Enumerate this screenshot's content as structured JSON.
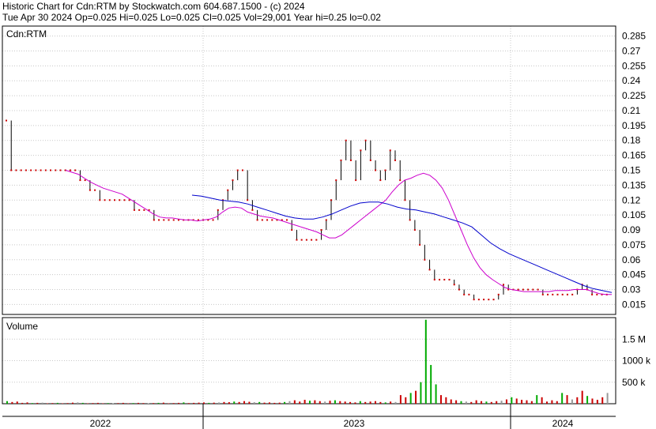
{
  "header": {
    "title": "Historic Chart for Cdn:RTM by Stockwatch.com 604.687.1500 - (c) 2024",
    "stats": "Tue Apr 30 2024  Op=0.025  Hi=0.025  Lo=0.025  Cl=0.025  Vol=29,001  Year hi=0.25  lo=0.02"
  },
  "price_panel": {
    "label": "Cdn:RTM"
  },
  "volume_panel": {
    "label": "Volume"
  },
  "colors": {
    "grid": "#c8c8c8",
    "bar": "#000000",
    "dot": "#cc0000",
    "ma_short": "#cc00cc",
    "ma_long": "#0000cc",
    "vol_up": "#00aa00",
    "vol_down": "#cc0000",
    "vol_flat": "#999999"
  },
  "chart_data": [
    {
      "type": "line",
      "title": "Cdn:RTM",
      "x_labels": [
        "2022",
        "2023",
        "2024"
      ],
      "y_ticks": [
        0.015,
        0.03,
        0.045,
        0.06,
        0.075,
        0.09,
        0.105,
        0.12,
        0.135,
        0.15,
        0.165,
        0.18,
        0.195,
        0.21,
        0.225,
        0.24,
        0.255,
        0.27,
        0.285
      ],
      "ylim": [
        0.005,
        0.295
      ],
      "grid": true,
      "series": [
        {
          "style": "price",
          "values": [
            0.2,
            0.15,
            0.15,
            0.15,
            0.15,
            0.15,
            0.15,
            0.15,
            0.15,
            0.15,
            0.15,
            0.15,
            0.15,
            0.15,
            0.15,
            0.14,
            0.14,
            0.13,
            0.13,
            0.12,
            0.12,
            0.12,
            0.12,
            0.12,
            0.12,
            0.12,
            0.11,
            0.11,
            0.11,
            0.11,
            0.1,
            0.1,
            0.1,
            0.1,
            0.1,
            0.1,
            0.1,
            0.1,
            0.1,
            0.1,
            0.1,
            0.1,
            0.1,
            0.11,
            0.12,
            0.13,
            0.14,
            0.15,
            0.15,
            0.12,
            0.11,
            0.1,
            0.1,
            0.1,
            0.1,
            0.1,
            0.1,
            0.1,
            0.09,
            0.08,
            0.08,
            0.08,
            0.08,
            0.08,
            0.09,
            0.1,
            0.12,
            0.14,
            0.16,
            0.18,
            0.16,
            0.14,
            0.17,
            0.18,
            0.16,
            0.15,
            0.14,
            0.15,
            0.17,
            0.16,
            0.14,
            0.12,
            0.1,
            0.09,
            0.075,
            0.06,
            0.05,
            0.04,
            0.04,
            0.04,
            0.04,
            0.035,
            0.03,
            0.025,
            0.025,
            0.02,
            0.02,
            0.02,
            0.02,
            0.02,
            0.025,
            0.035,
            0.03,
            0.03,
            0.03,
            0.03,
            0.03,
            0.03,
            0.03,
            0.025,
            0.025,
            0.025,
            0.025,
            0.025,
            0.025,
            0.025,
            0.03,
            0.035,
            0.03,
            0.025,
            0.025,
            0.025,
            0.025
          ]
        },
        {
          "name": "",
          "style": "ma_short",
          "values": [
            0.15,
            0.148,
            0.146,
            0.142,
            0.138,
            0.135,
            0.132,
            0.13,
            0.128,
            0.126,
            0.122,
            0.118,
            0.114,
            0.11,
            0.106,
            0.103,
            0.102,
            0.102,
            0.101,
            0.1,
            0.1,
            0.099,
            0.1,
            0.101,
            0.103,
            0.108,
            0.112,
            0.113,
            0.112,
            0.108,
            0.106,
            0.104,
            0.103,
            0.102,
            0.1,
            0.098,
            0.096,
            0.094,
            0.092,
            0.09,
            0.088,
            0.085,
            0.082,
            0.082,
            0.085,
            0.09,
            0.095,
            0.1,
            0.105,
            0.11,
            0.115,
            0.12,
            0.128,
            0.135,
            0.14,
            0.142,
            0.145,
            0.147,
            0.145,
            0.14,
            0.132,
            0.12,
            0.105,
            0.09,
            0.075,
            0.062,
            0.052,
            0.045,
            0.04,
            0.036,
            0.032,
            0.03,
            0.029,
            0.028,
            0.028,
            0.028,
            0.028,
            0.028,
            0.029,
            0.029,
            0.029,
            0.03,
            0.03,
            0.03,
            0.028,
            0.026,
            0.025,
            0.025
          ]
        },
        {
          "name": "",
          "style": "ma_long",
          "values": [
            0.125,
            0.124,
            0.122,
            0.12,
            0.119,
            0.118,
            0.116,
            0.113,
            0.11,
            0.107,
            0.104,
            0.102,
            0.101,
            0.101,
            0.103,
            0.106,
            0.11,
            0.114,
            0.117,
            0.118,
            0.118,
            0.116,
            0.113,
            0.111,
            0.11,
            0.108,
            0.106,
            0.103,
            0.1,
            0.097,
            0.093,
            0.085,
            0.077,
            0.071,
            0.066,
            0.062,
            0.058,
            0.054,
            0.05,
            0.046,
            0.042,
            0.038,
            0.034,
            0.031,
            0.029,
            0.027
          ]
        }
      ]
    },
    {
      "type": "bar",
      "title": "Volume",
      "y_ticks": [
        "500 k",
        "1000 k",
        "1.5 M"
      ],
      "ylim": [
        0,
        2000000
      ],
      "values": [
        60000,
        40000,
        50000,
        20000,
        30000,
        15000,
        20000,
        25000,
        10000,
        15000,
        20000,
        10000,
        15000,
        25000,
        30000,
        20000,
        10000,
        15000,
        20000,
        10000,
        15000,
        10000,
        15000,
        20000,
        10000,
        15000,
        20000,
        15000,
        10000,
        15000,
        20000,
        25000,
        10000,
        15000,
        20000,
        30000,
        15000,
        20000,
        25000,
        30000,
        20000,
        25000,
        30000,
        40000,
        35000,
        50000,
        40000,
        60000,
        45000,
        35000,
        40000,
        25000,
        30000,
        20000,
        25000,
        40000,
        60000,
        80000,
        50000,
        90000,
        70000,
        80000,
        60000,
        50000,
        70000,
        80000,
        60000,
        50000,
        40000,
        30000,
        60000,
        40000,
        50000,
        60000,
        40000,
        30000,
        50000,
        40000,
        200000,
        150000,
        250000,
        300000,
        500000,
        1950000,
        900000,
        450000,
        200000,
        150000,
        100000,
        80000,
        60000,
        50000,
        40000,
        80000,
        60000,
        50000,
        40000,
        60000,
        70000,
        100000,
        150000,
        120000,
        90000,
        80000,
        60000,
        200000,
        150000,
        50000,
        80000,
        60000,
        250000,
        200000,
        100000,
        150000,
        300000,
        180000,
        120000,
        90000,
        150000,
        250000
      ]
    }
  ]
}
